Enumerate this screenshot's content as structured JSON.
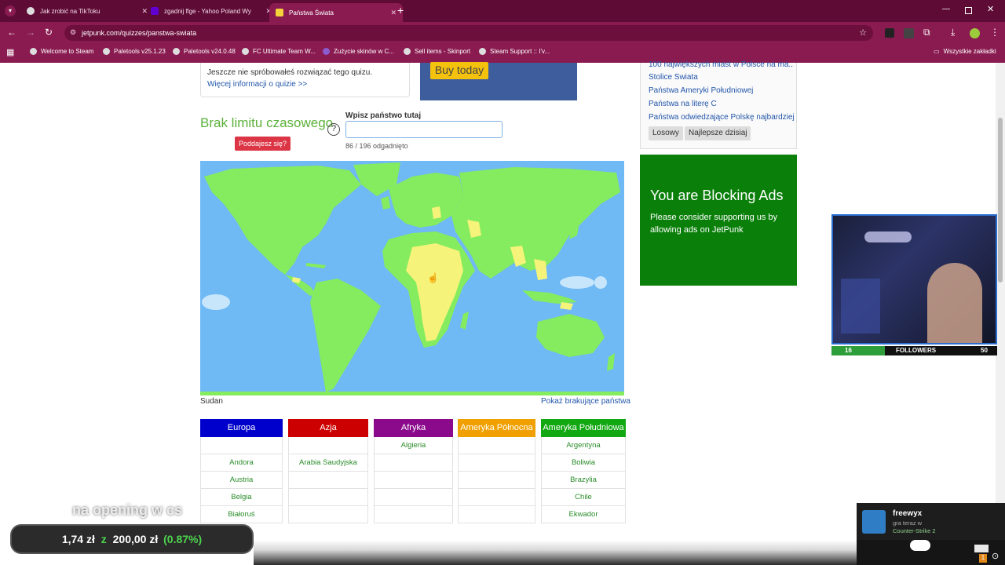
{
  "tabs": [
    {
      "title": "Jak zrobić na TikToku",
      "active": false
    },
    {
      "title": "zgadnij flge - Yahoo Poland Wy",
      "active": false
    },
    {
      "title": "Państwa Świata",
      "active": true
    }
  ],
  "address": {
    "url": "jetpunk.com/quizzes/panstwa-swiata"
  },
  "bookmarks": [
    "Welcome to Steam",
    "Paletools v25.1.23",
    "Paletools v24.0.48",
    "FC Ultimate Team W...",
    "Zużycie skinów w C...",
    "Sell items - Skinport",
    "Steam Support :: I'v..."
  ],
  "bookmarks_folder": "Wszystkie zakładki",
  "quiz_info": {
    "line1": "Jeszcze nie spróbowałeś rozwiązać tego quizu.",
    "more_link": "Więcej informacji o quizie >>"
  },
  "ad": {
    "buy_label": "Buy today"
  },
  "sidebar": {
    "links": [
      "100 największych miast w Polsce na ma...",
      "Stolice Świata",
      "Państwa Ameryki Południowej",
      "Państwa na literę C",
      "Państwa odwiedzające Polskę najbardziej"
    ],
    "random_label": "Losowy",
    "best_label": "Najlepsze dzisiaj"
  },
  "quiz": {
    "timer_label": "Brak limitu czasowego",
    "help_symbol": "?",
    "giveup_label": "Poddajesz się?",
    "input_label": "Wpisz państwo tutaj",
    "input_value": "",
    "progress": "86 / 196 odgadnięto",
    "current_country": "Sudan",
    "show_missing": "Pokaż brakujące państwa"
  },
  "map_colors": {
    "ocean": "#6fb9f4",
    "guessed": "#84ec5e",
    "missing": "#f6f37a",
    "lake": "#c8e6fb"
  },
  "columns": [
    {
      "name": "Europa",
      "color": "#0000cc",
      "items": [
        "",
        "Andora",
        "Austria",
        "Belgia",
        "Białoruś"
      ]
    },
    {
      "name": "Azja",
      "color": "#cc0000",
      "items": [
        "",
        "Arabia Saudyjska",
        "",
        "",
        ""
      ]
    },
    {
      "name": "Afryka",
      "color": "#8b0a8b",
      "items": [
        "Algieria",
        "",
        "",
        "",
        ""
      ]
    },
    {
      "name": "Ameryka Północna",
      "color": "#f0a000",
      "items": [
        "",
        "",
        "",
        "",
        ""
      ]
    },
    {
      "name": "Ameryka Południowa",
      "color": "#12a812",
      "items": [
        "Argentyna",
        "Boliwia",
        "Brazylia",
        "Chile",
        "Ekwador"
      ]
    }
  ],
  "adblock": {
    "title": "You are Blocking Ads",
    "text": "Please consider supporting us by allowing ads on JetPunk"
  },
  "stream": {
    "followers_label": "FOLLOWERS",
    "followers_current": "16",
    "followers_goal": "50",
    "followers_fraction": 0.32,
    "overlay_text": "na opening w cs",
    "donation": {
      "amount": "1,74 zł",
      "separator": "z",
      "goal": "200,00 zł",
      "percent": "(0.87%)"
    },
    "notification": {
      "user": "freewyx",
      "line": "gra teraz w",
      "game": "Counter-Strike 2"
    },
    "badge_count": "1"
  }
}
